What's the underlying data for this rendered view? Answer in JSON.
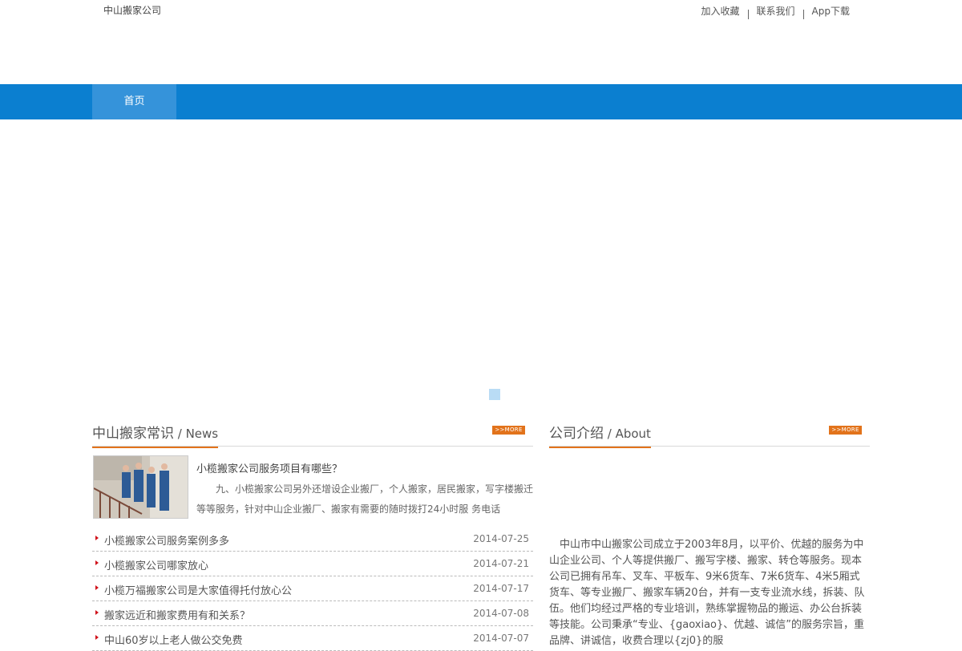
{
  "header": {
    "site_title": "中山搬家公司",
    "links": [
      "加入收藏",
      "联系我们",
      "App下载"
    ]
  },
  "nav": {
    "items": [
      "首页"
    ]
  },
  "news": {
    "title_cn": "中山搬家常识",
    "title_en": " / News",
    "more": ">>MORE",
    "feature": {
      "title": "小榄搬家公司服务项目有哪些？",
      "desc": "九、小榄搬家公司另外还增设企业搬厂，个人搬家，居民搬家，写字楼搬迁等等服务，针对中山企业搬厂、搬家有需要的随时拨打24小时服 务电话"
    },
    "items": [
      {
        "title": "小榄搬家公司服务案例多多",
        "date": "2014-07-25"
      },
      {
        "title": "小榄搬家公司哪家放心",
        "date": "2014-07-21"
      },
      {
        "title": "小榄万福搬家公司是大家值得托付放心公",
        "date": "2014-07-17"
      },
      {
        "title": "搬家远近和搬家费用有和关系？",
        "date": "2014-07-08"
      },
      {
        "title": "中山60岁以上老人做公交免费",
        "date": "2014-07-07"
      }
    ]
  },
  "about": {
    "title_cn": "公司介绍",
    "title_en": " / About",
    "more": ">>MORE",
    "text": "中山市中山搬家公司成立于2003年8月，以平价、优越的服务为中山企业公司、个人等提供搬厂、搬写字楼、搬家、转仓等服务。现本公司已拥有吊车、叉车、平板车、9米6货车、7米6货车、4米5厢式货车、等专业搬厂、搬家车辆20台，并有一支专业流水线，拆装、队伍。他们均经过严格的专业培训，熟练掌握物品的搬运、办公台拆装等技能。公司秉承“专业、{gaoxiao}、优越、诚信”的服务宗旨，重品牌、讲诚信，收费合理以{zj0}的服"
  },
  "colors": {
    "nav_bg": "#0b7fd0",
    "nav_active": "#3593da",
    "accent": "#e2731b",
    "bullet": "#d0121b"
  }
}
